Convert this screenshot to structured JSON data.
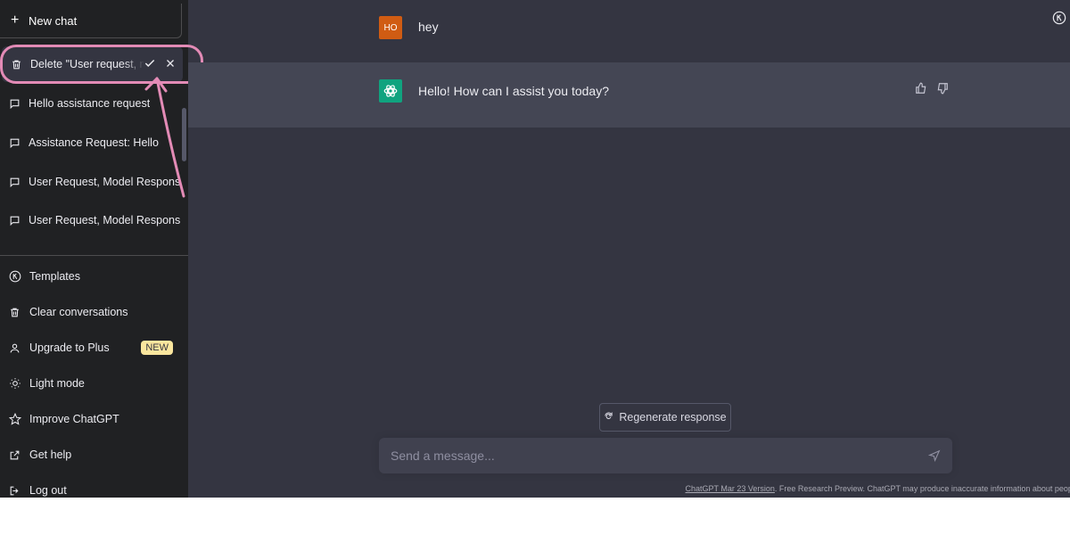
{
  "sidebar": {
    "new_chat": {
      "label": "New chat"
    },
    "chats": [
      {
        "label": "Delete \"User request, m",
        "state": "confirm-delete"
      },
      {
        "label": "Hello assistance request"
      },
      {
        "label": "Assistance Request: Hello"
      },
      {
        "label": "User Request, Model Respons"
      },
      {
        "label": "User Request, Model Respons"
      }
    ],
    "menu": [
      {
        "label": "Templates",
        "icon": "k-circle-icon"
      },
      {
        "label": "Clear conversations",
        "icon": "trash-icon"
      },
      {
        "label": "Upgrade to Plus",
        "icon": "user-icon",
        "badge": "NEW"
      },
      {
        "label": "Light mode",
        "icon": "sun-icon"
      },
      {
        "label": "Improve ChatGPT",
        "icon": "star-icon"
      },
      {
        "label": "Get help",
        "icon": "external-link-icon"
      },
      {
        "label": "Log out",
        "icon": "logout-icon"
      }
    ]
  },
  "conversation": {
    "user": {
      "avatar_text": "HO",
      "message": "hey"
    },
    "assistant": {
      "message": "Hello! How can I assist you today?"
    }
  },
  "regenerate_label": "Regenerate response",
  "composer": {
    "placeholder": "Send a message..."
  },
  "footer": {
    "link": "ChatGPT Mar 23 Version",
    "text": ". Free Research Preview. ChatGPT may produce inaccurate information about people, places, or facts"
  },
  "colors": {
    "sidebar_bg": "#202123",
    "main_bg": "#343541",
    "assistant_bg": "#444654",
    "accent_green": "#10a37f",
    "user_avatar": "#d05c13",
    "annotation_pink": "#e38bb6"
  }
}
